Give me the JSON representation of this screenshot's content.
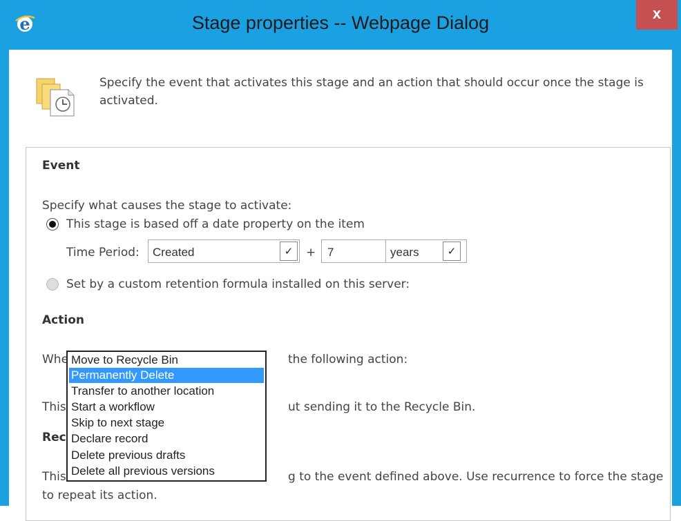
{
  "window": {
    "title": "Stage properties -- Webpage Dialog",
    "close_label": "x"
  },
  "intro": {
    "text": "Specify the event that activates this stage and an action that should occur once the stage is activated."
  },
  "event": {
    "heading": "Event",
    "prompt": "Specify what causes the stage to activate:",
    "option_date": "This stage is based off a date property on the item",
    "time_period_label": "Time Period:",
    "date_property": "Created",
    "plus": "+",
    "amount": "7",
    "unit": "years",
    "option_formula": "Set by a custom retention formula installed on this server:"
  },
  "action": {
    "heading": "Action",
    "when_prefix": "Whe",
    "when_suffix": "the following action:",
    "desc_prefix": "This",
    "desc_suffix": "ut sending it to the Recycle Bin."
  },
  "recurrence": {
    "heading_prefix": "Rec",
    "text_prefix": "This",
    "text_suffix": "g to the event defined above. Use recurrence to force the stage",
    "text_line2": "to repeat its action."
  },
  "dropdown": {
    "options": [
      "Move to Recycle Bin",
      "Permanently Delete",
      "Transfer to another location",
      "Start a workflow",
      "Skip to next stage",
      "Declare record",
      "Delete previous drafts",
      "Delete all previous versions"
    ],
    "selected": "Permanently Delete"
  },
  "colors": {
    "frame_accent": "#1ba1e2",
    "close_button": "#c75050",
    "selection": "#3399ff"
  }
}
